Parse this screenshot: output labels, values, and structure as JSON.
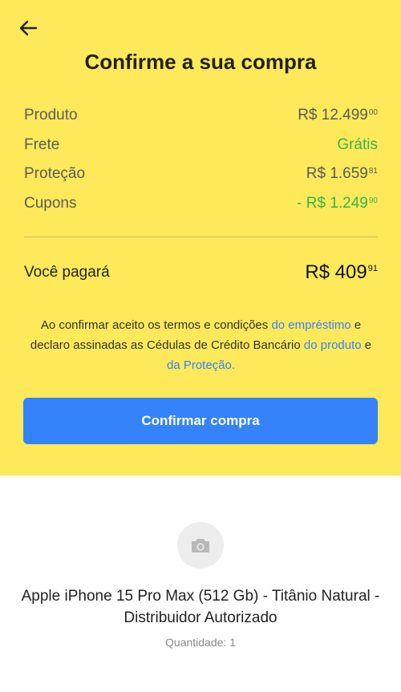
{
  "header": {
    "title": "Confirme a sua compra",
    "back_icon": "arrow-left-icon"
  },
  "summary": {
    "rows": [
      {
        "label": "Produto",
        "amount": "R$ 12.499",
        "cents": "00",
        "color": "#5b5b5b"
      },
      {
        "label": "Frete",
        "amount": "Grátis",
        "cents": "",
        "color": "#38b449"
      },
      {
        "label": "Proteção",
        "amount": "R$ 1.659",
        "cents": "81",
        "color": "#5b5b5b"
      },
      {
        "label": "Cupons",
        "amount": "- R$ 1.249",
        "cents": "90",
        "color": "#38b449"
      }
    ],
    "total": {
      "label": "Você pagará",
      "amount": "R$ 409",
      "cents": "91"
    }
  },
  "terms": {
    "part1": "Ao confirmar aceito os termos e condições ",
    "link_loan": "do empréstimo",
    "part2": " e declaro assinadas as Cédulas de Crédito Bancário ",
    "link_product": "do produto",
    "part3": " e ",
    "link_protection": "da Proteção."
  },
  "cta": {
    "label": "Confirmar compra",
    "color": "#3483fa"
  },
  "product": {
    "thumbnail_icon": "camera-icon",
    "name": "Apple iPhone 15 Pro Max (512 Gb) - Titânio Natural - Distribuidor Autorizado",
    "quantity": "Quantidade: 1"
  },
  "colors": {
    "header_bg": "#fde95a",
    "accent": "#3483fa",
    "positive": "#38b449"
  }
}
